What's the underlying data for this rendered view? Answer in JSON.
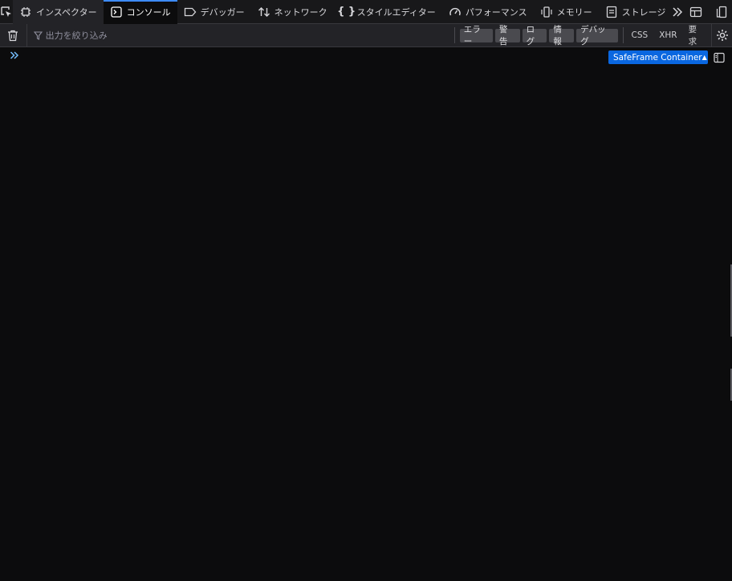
{
  "tabs": [
    {
      "label": "インスペクター",
      "icon": "inspector-icon"
    },
    {
      "label": "コンソール",
      "icon": "console-icon",
      "selected": true
    },
    {
      "label": "デバッガー",
      "icon": "debugger-icon"
    },
    {
      "label": "ネットワーク",
      "icon": "network-icon"
    },
    {
      "label": "スタイルエディター",
      "icon": "style-editor-icon"
    },
    {
      "label": "パフォーマンス",
      "icon": "performance-icon"
    },
    {
      "label": "メモリー",
      "icon": "memory-icon"
    },
    {
      "label": "ストレージ",
      "icon": "storage-icon"
    }
  ],
  "toolbar": {
    "filter_placeholder": "出力を絞り込み",
    "levels": [
      "エラー",
      "警告",
      "ログ",
      "情報",
      "デバッグ"
    ],
    "categories": [
      "CSS",
      "XHR",
      "要求"
    ]
  },
  "console": {
    "context_selector": "SafeFrame Container"
  },
  "colors": {
    "accent": "#0a67e0",
    "selected_tab_indicator": "#3d8bff",
    "background": "#0c0c0d",
    "toolbar": "#232327"
  }
}
